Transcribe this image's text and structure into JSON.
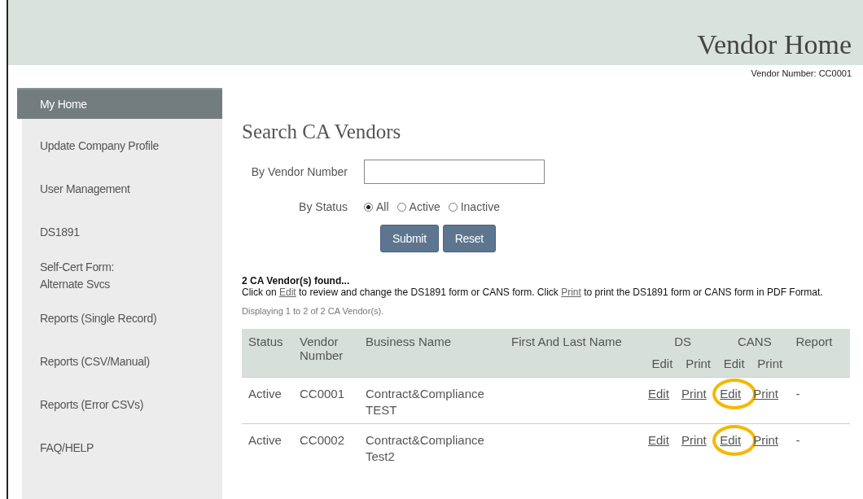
{
  "header": {
    "title": "Vendor Home",
    "vendor_number": "Vendor Number: CC0001"
  },
  "sidebar": {
    "items": [
      {
        "label": "My Home",
        "selected": true
      },
      {
        "label": "Update Company Profile",
        "selected": false
      },
      {
        "label": "User Management",
        "selected": false
      },
      {
        "label": "DS1891",
        "selected": false
      },
      {
        "label": "Self-Cert Form:\nAlternate Svcs",
        "selected": false
      },
      {
        "label": "Reports (Single Record)",
        "selected": false
      },
      {
        "label": "Reports (CSV/Manual)",
        "selected": false
      },
      {
        "label": "Reports (Error CSVs)",
        "selected": false
      },
      {
        "label": "FAQ/HELP",
        "selected": false
      }
    ]
  },
  "search": {
    "title": "Search CA Vendors",
    "vendor_number": {
      "label": "By Vendor Number"
    },
    "status": {
      "label": "By Status",
      "options": [
        {
          "label": "All",
          "selected": true
        },
        {
          "label": "Active",
          "selected": false
        },
        {
          "label": "Inactive",
          "selected": false
        }
      ]
    },
    "buttons": [
      "Submit",
      "Reset"
    ]
  },
  "results": {
    "found": "2 CA Vendor(s) found...",
    "instructions": [
      {
        "kind": "text",
        "text": "Click on "
      },
      {
        "kind": "link",
        "text": "Edit"
      },
      {
        "kind": "text",
        "text": " to review and change the DS1891 form or CANS form. Click "
      },
      {
        "kind": "link",
        "text": "Print"
      },
      {
        "kind": "text",
        "text": " to print the DS1891 form or CANS form in PDF Format."
      }
    ],
    "displaying": "Displaying 1 to 2 of 2 CA Vendor(s)."
  },
  "table": {
    "columns": [
      {
        "label": "Status"
      },
      {
        "label": "Vendor Number"
      },
      {
        "label": "Business Name"
      },
      {
        "label": "First And Last Name"
      },
      {
        "label": "DS",
        "subcolumns": [
          "Edit",
          "Print"
        ]
      },
      {
        "label": "CANS",
        "subcolumns": [
          "Edit",
          "Print"
        ]
      },
      {
        "label": "Report"
      }
    ],
    "rows": [
      {
        "status": "Active",
        "vendor_number": "CC0001",
        "business_name": "Contract&Compliance TEST",
        "ds_edit": "Edit",
        "ds_print": "Print",
        "cans_edit": "Edit",
        "cans_print": "Print",
        "report": "-",
        "cans_edit_circled": true
      },
      {
        "status": "Active",
        "vendor_number": "CC0002",
        "business_name": "Contract&Compliance Test2",
        "ds_edit": "Edit",
        "ds_print": "Print",
        "cans_edit": "Edit",
        "cans_print": "Print",
        "report": "-",
        "cans_edit_circled": true
      }
    ]
  }
}
